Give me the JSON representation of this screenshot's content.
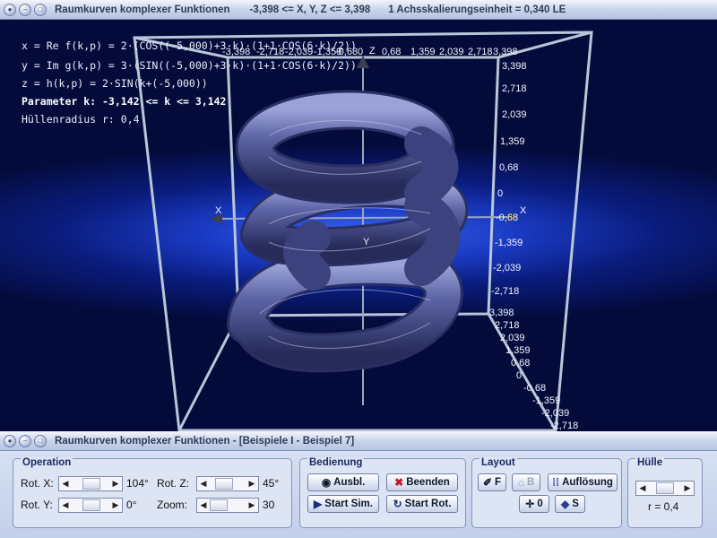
{
  "window": {
    "title": "Raumkurven komplexer Funktionen",
    "range_info": "-3,398 <= X, Y, Z <= 3,398",
    "scale_info": "1 Achsskalierungseinheit = 0,340 LE"
  },
  "formulas": {
    "x": "x = Re f(k,p) = 2·(COS((-5,000)+3·k)·(1+1·COS(6·k)/2))",
    "y": "y = Im g(k,p) = 3·(SIN((-5,000)+3·k)·(1+1·COS(6·k)/2))",
    "z": "z = h(k,p) = 2·SIN(k+(-5,000))",
    "param": "Parameter k: -3,142 <= k <= 3,142",
    "radius": "Hüllenradius r: 0,4"
  },
  "axes": {
    "x_label": "X",
    "x_label_left": "X",
    "y_label": "Y",
    "z_label": "Z",
    "top_ticks": [
      "-3,398",
      "-2,718",
      "-2,039",
      "-1,359",
      "-0,68",
      "0",
      "0,68",
      "1,359",
      "2,039",
      "2,718",
      "3,398"
    ],
    "right_ticks": [
      "3,398",
      "2,718",
      "2,039",
      "1,359",
      "0,68",
      "0",
      "-0,68",
      "-1,359",
      "-2,039",
      "-2,718"
    ],
    "diag_ticks": [
      "3,398",
      "2,718",
      "2,039",
      "1,359",
      "0,68",
      "0",
      "-0,68",
      "-1,359",
      "-2,039",
      "-2,718"
    ]
  },
  "subwindow": {
    "title": "Raumkurven komplexer Funktionen - [Beispiele I - Beispiel 7]"
  },
  "operation": {
    "label": "Operation",
    "rot_x_label": "Rot. X:",
    "rot_x_value": "104°",
    "rot_z_label": "Rot. Z:",
    "rot_z_value": "45°",
    "rot_y_label": "Rot. Y:",
    "rot_y_value": "0°",
    "zoom_label": "Zoom:",
    "zoom_value": "30"
  },
  "bedienung": {
    "label": "Bedienung",
    "ausbl": "Ausbl.",
    "beenden": "Beenden",
    "start_sim": "Start Sim.",
    "start_rot": "Start Rot."
  },
  "layout": {
    "label": "Layout",
    "f": "F",
    "b": "B",
    "aufloesung": "Auflösung",
    "zero": "0",
    "s": "S"
  },
  "huelle": {
    "label": "Hülle",
    "value": "r = 0,4"
  },
  "colors": {
    "background_center": "#3a63e8",
    "background_edge": "#040b3a",
    "tube": "#4e5590",
    "frame": "#b8c6d8"
  }
}
